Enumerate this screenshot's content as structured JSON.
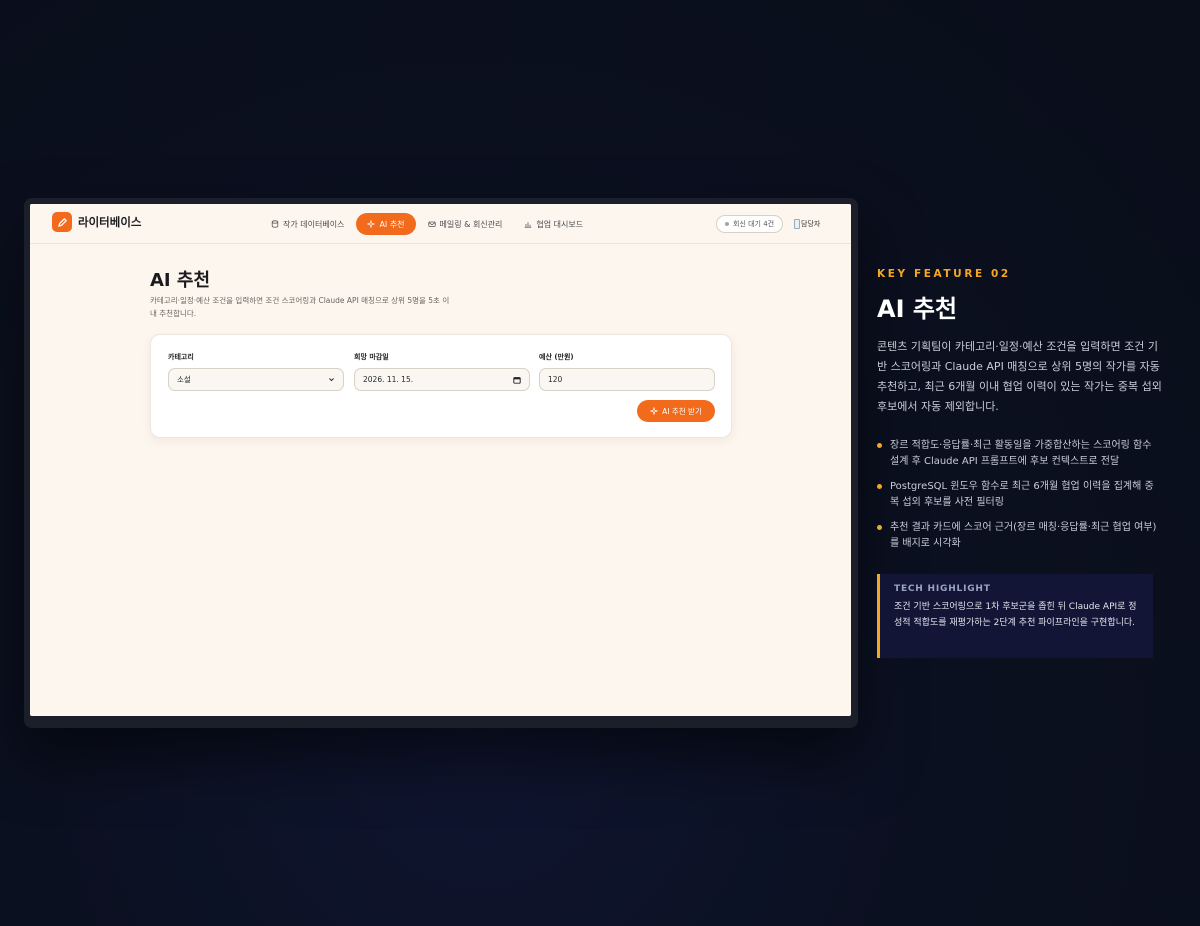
{
  "app": {
    "brand": "라이터베이스",
    "nav": [
      {
        "label": "작가 데이터베이스",
        "icon": "database-icon"
      },
      {
        "label": "AI 추천",
        "icon": "sparkle-icon",
        "active": true
      },
      {
        "label": "메일링 & 회신관리",
        "icon": "mail-icon"
      },
      {
        "label": "협업 대시보드",
        "icon": "chart-icon"
      }
    ],
    "pending": "회신 대기 4건",
    "user": "담당자"
  },
  "page": {
    "title": "AI 추천",
    "desc": "카테고리·일정·예산 조건을 입력하면 조건 스코어링과 Claude API 매칭으로 상위 5명을 5초 이내 추천합니다.",
    "form": {
      "category": {
        "label": "카테고리",
        "value": "소설"
      },
      "deadline": {
        "label": "희망 마감일",
        "value": "2026. 11. 15."
      },
      "budget": {
        "label": "예산 (만원)",
        "value": "120"
      },
      "submit": "AI 추천 받기"
    }
  },
  "panel": {
    "kicker": "KEY FEATURE 02",
    "title": "AI 추천",
    "desc": "콘텐츠 기획팀이 카테고리·일정·예산 조건을 입력하면 조건 기반 스코어링과 Claude API 매칭으로 상위 5명의 작가를 자동 추천하고, 최근 6개월 이내 협업 이력이 있는 작가는 중복 섭외 후보에서 자동 제외합니다.",
    "bullets": [
      "장르 적합도·응답률·최근 활동일을 가중합산하는 스코어링 함수 설계 후 Claude API 프롬프트에 후보 컨텍스트로 전달",
      "PostgreSQL 윈도우 함수로 최근 6개월 협업 이력을 집계해 중복 섭외 후보를 사전 필터링",
      "추천 결과 카드에 스코어 근거(장르 매칭·응답률·최근 협업 여부)를 배지로 시각화"
    ],
    "tech_label": "TECH HIGHLIGHT",
    "tech_text": "조건 기반 스코어링으로 1차 후보군을 좁힌 뒤 Claude API로 정성적 적합도를 재평가하는 2단계 추천 파이프라인을 구현합니다."
  },
  "colors": {
    "accent": "#f26a1b",
    "highlight": "#f5a623",
    "background": "#0b1020"
  }
}
